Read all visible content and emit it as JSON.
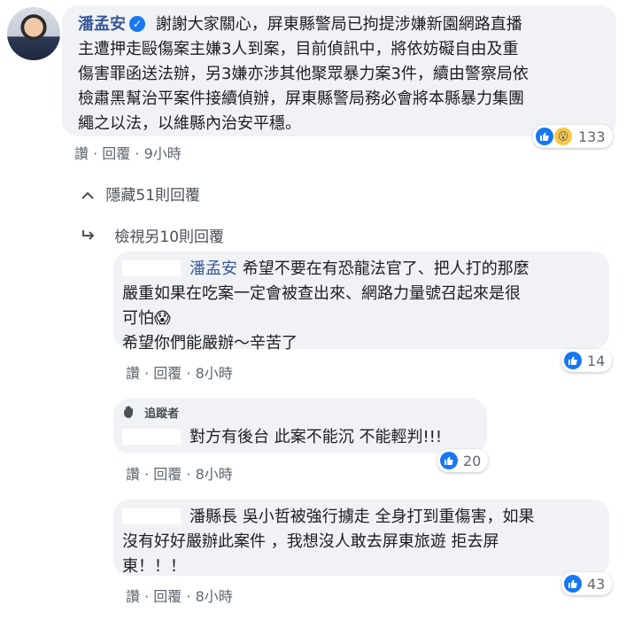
{
  "post_comment": {
    "author": "潘孟安",
    "lines": [
      "謝謝大家關心，屏東縣警局已拘提涉嫌新園網路直播",
      "主遭押走毆傷案主嫌3人到案，目前偵訊中，將依妨礙自由及重",
      "傷害罪函送法辦，另3嫌亦涉其他聚眾暴力案3件，續由警察局依",
      "檢肅黑幫治平案件接續偵辦，屏東縣警局務必會將本縣暴力集團",
      "繩之以法，以維縣內治安平穩。"
    ],
    "actions": {
      "like": "讚",
      "reply": "回覆",
      "time": "9小時",
      "sep": "·"
    },
    "reaction_count": "133"
  },
  "hide_replies": "隱藏51則回覆",
  "view_more_replies": "檢視另10則回覆",
  "replies": [
    {
      "mention": "潘孟安",
      "lines": [
        "希望不要在有恐龍法官了、把人打的那麼",
        "嚴重如果在吃案一定會被查出來、網路力量號召起來是很",
        "可怕",
        "希望你們能嚴辦～辛苦了"
      ],
      "emoji": "😱",
      "actions": {
        "like": "讚",
        "reply": "回覆",
        "time": "8小時",
        "sep": "·"
      },
      "reaction_count": "14"
    },
    {
      "badge": "追蹤者",
      "lines": [
        "對方有後台 此案不能沉 不能輕判!!!"
      ],
      "actions": {
        "like": "讚",
        "reply": "回覆",
        "time": "8小時",
        "sep": "·"
      },
      "reaction_count": "20"
    },
    {
      "lines": [
        "潘縣長 吳小哲被強行擄走 全身打到重傷害，如果",
        "沒有好好嚴辦此案件 ，我想沒人敢去屏東旅遊 拒去屏",
        "東！！！"
      ],
      "actions": {
        "like": "讚",
        "reply": "回覆",
        "time": "8小時",
        "sep": "·"
      },
      "reaction_count": "43"
    }
  ],
  "colors": {
    "bubble": "#f0f2f5",
    "link": "#385898",
    "like_blue": "#1877f2",
    "meta_gray": "#606770"
  }
}
